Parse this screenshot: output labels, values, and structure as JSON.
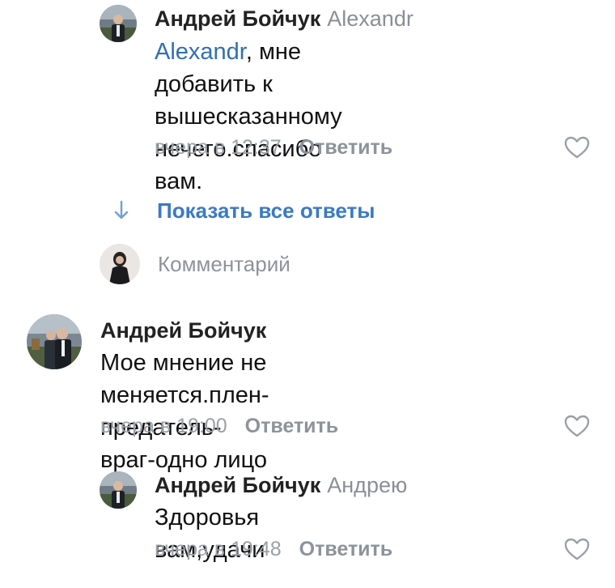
{
  "comments": [
    {
      "author": "Андрей Бойчук",
      "reply_to": "Alexandr",
      "mention": "Alexandr",
      "text_line1": ", мне добавить к",
      "text_line2": "вышесказанному нечего.спасибо",
      "text_line3": "вам.",
      "time": "вчера в 12:37",
      "reply_label": "Ответить"
    },
    {
      "author": "Андрей Бойчук",
      "text_line1": "Мое мнение не",
      "text_line2": "меняется.плен-предатель-враг-одно лицо",
      "time": "вчера в 19:00",
      "reply_label": "Ответить"
    },
    {
      "author": "Андрей Бойчук",
      "reply_to": "Андрею",
      "text_line1": "Здоровья вам,удачи",
      "time": "вчера в 19:48",
      "reply_label": "Ответить"
    }
  ],
  "show_all_replies": "Показать все ответы",
  "composer": {
    "placeholder": "Комментарий"
  },
  "icons": {
    "like": "heart-outline-icon",
    "expand": "arrow-down-icon"
  },
  "colors": {
    "link": "#3a7ac4",
    "meta": "#9aa0a6"
  }
}
